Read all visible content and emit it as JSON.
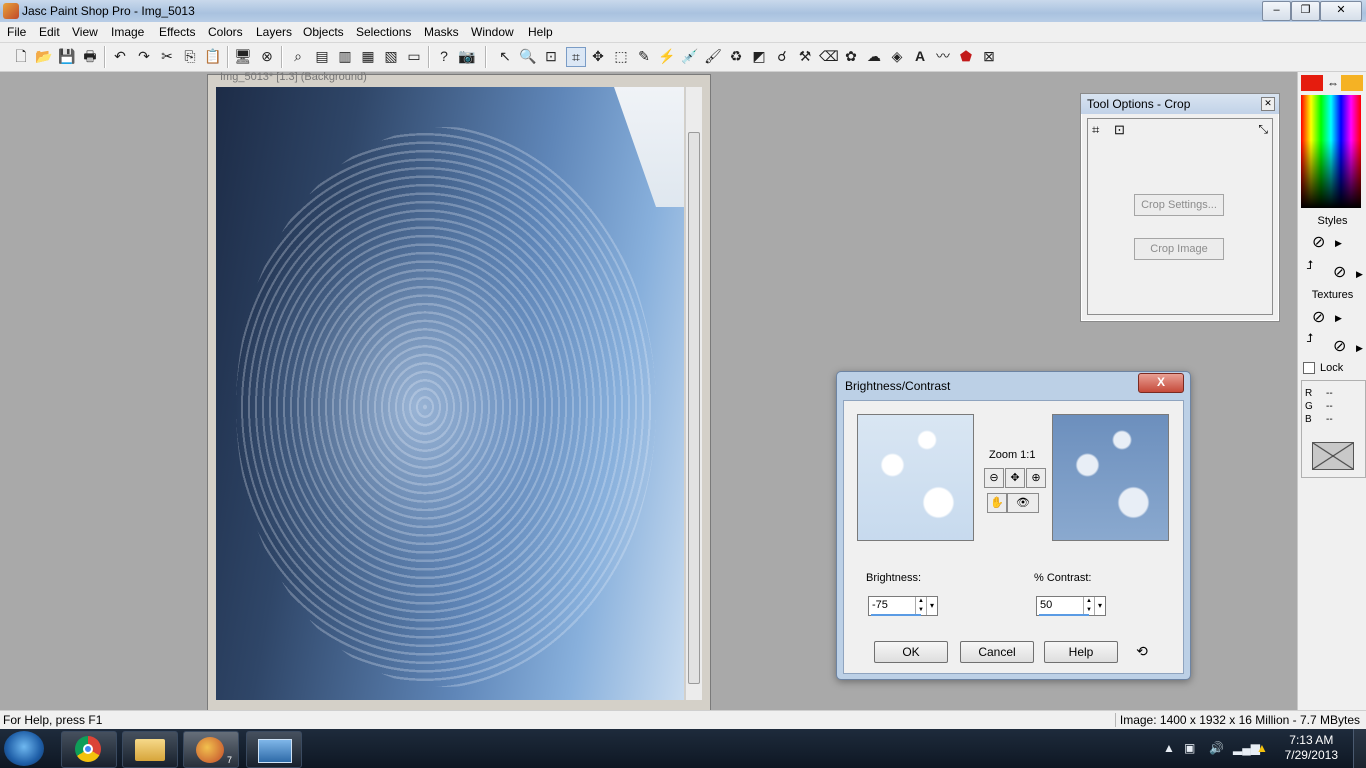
{
  "window": {
    "title": "Jasc Paint Shop Pro - Img_5013",
    "minimize": "–",
    "restore": "❐",
    "close": "✕"
  },
  "menu": [
    "File",
    "Edit",
    "View",
    "Image",
    "Effects",
    "Colors",
    "Layers",
    "Objects",
    "Selections",
    "Masks",
    "Window",
    "Help"
  ],
  "image_window": {
    "title": "Img_5013* [1:3] (Background)"
  },
  "tool_options": {
    "title": "Tool Options - Crop",
    "close": "✕",
    "crop_settings": "Crop Settings...",
    "crop_image": "Crop Image"
  },
  "palette": {
    "swap": "⇔",
    "styles": "Styles",
    "textures": "Textures",
    "lock": "Lock",
    "r": "R",
    "g": "G",
    "b": "B",
    "r_val": "--",
    "g_val": "--",
    "b_val": "--",
    "no": "⃠"
  },
  "dialog": {
    "title": "Brightness/Contrast",
    "close": "X",
    "zoom": "Zoom 1:1",
    "brightness_label": "Brightness:",
    "brightness_value": "-75",
    "contrast_label": "% Contrast:",
    "contrast_value": "50",
    "ok": "OK",
    "cancel": "Cancel",
    "help": "Help"
  },
  "status": {
    "help": "For Help, press F1",
    "image_info": "Image:  1400 x 1932 x 16 Million - 7.7 MBytes"
  },
  "clock": {
    "time": "7:13 AM",
    "date": "7/29/2013"
  },
  "taskbar": {
    "psp_badge": "7"
  },
  "colors": {
    "foreground": "#e51c0e",
    "background": "#f5b224"
  }
}
